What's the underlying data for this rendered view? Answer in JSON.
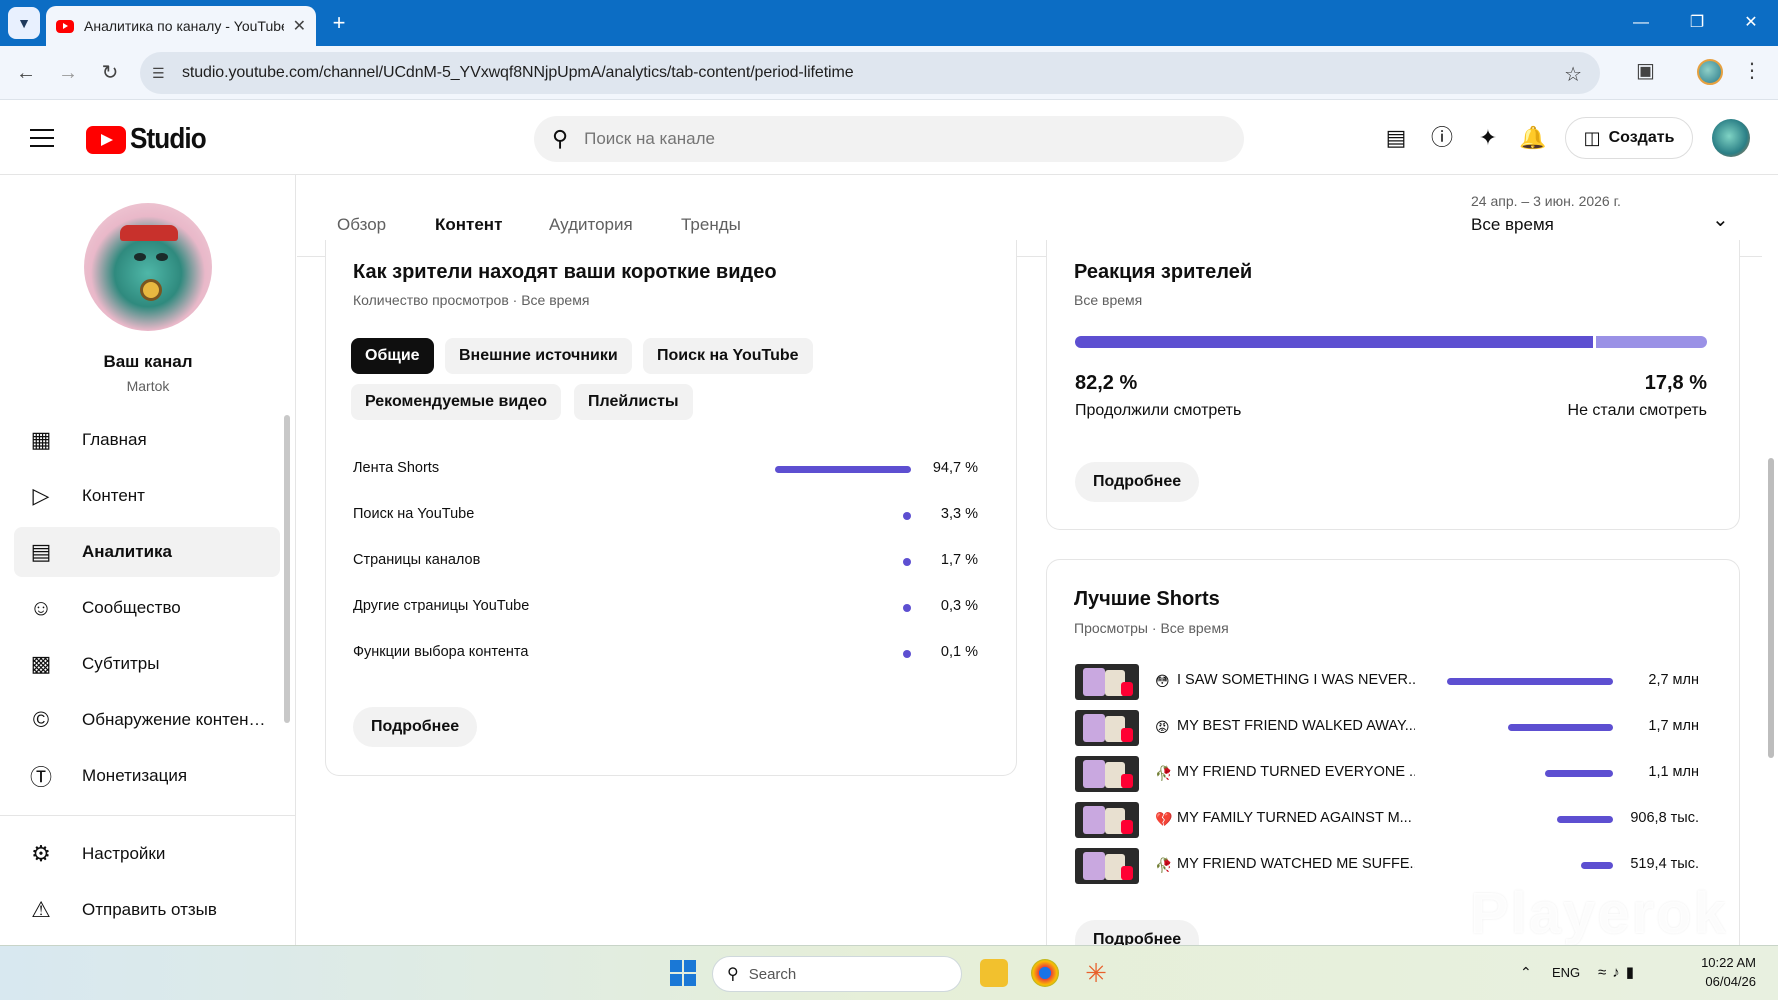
{
  "browser": {
    "tab_title": "Аналитика по каналу - YouTube",
    "url": "studio.youtube.com/channel/UCdnM-5_YVxwqf8NNjpUpmA/analytics/tab-content/period-lifetime"
  },
  "header": {
    "logo_text": "Studio",
    "search_placeholder": "Поиск на канале",
    "create_label": "Создать"
  },
  "sidebar": {
    "channel_name": "Ваш канал",
    "channel_handle": "Martok",
    "items": [
      {
        "label": "Главная",
        "icon": "dashboard-icon"
      },
      {
        "label": "Контент",
        "icon": "content-icon"
      },
      {
        "label": "Аналитика",
        "icon": "analytics-icon",
        "active": true
      },
      {
        "label": "Сообщество",
        "icon": "community-icon"
      },
      {
        "label": "Субтитры",
        "icon": "subtitles-icon"
      },
      {
        "label": "Обнаружение контен…",
        "icon": "copyright-icon"
      },
      {
        "label": "Монетизация",
        "icon": "dollar-icon"
      },
      {
        "label": "Настройки",
        "icon": "gear-icon"
      },
      {
        "label": "Отправить отзыв",
        "icon": "feedback-icon"
      }
    ]
  },
  "tabs": [
    {
      "label": "Обзор"
    },
    {
      "label": "Контент",
      "active": true
    },
    {
      "label": "Аудитория"
    },
    {
      "label": "Тренды"
    }
  ],
  "date": {
    "range": "24 апр. – 3 июн. 2026 г.",
    "value": "Все время"
  },
  "sources_card": {
    "title": "Как зрители находят ваши короткие видео",
    "subtitle": "Количество просмотров · Все время",
    "chips": [
      "Общие",
      "Внешние источники",
      "Поиск на YouTube",
      "Рекомендуемые видео",
      "Плейлисты"
    ],
    "rows": [
      {
        "label": "Лента Shorts",
        "value": "94,7 %",
        "pct": 94.7
      },
      {
        "label": "Поиск на YouTube",
        "value": "3,3 %",
        "pct": 3.3
      },
      {
        "label": "Страницы каналов",
        "value": "1,7 %",
        "pct": 1.7
      },
      {
        "label": "Другие страницы YouTube",
        "value": "0,3 %",
        "pct": 0.3
      },
      {
        "label": "Функции выбора контента",
        "value": "0,1 %",
        "pct": 0.1
      }
    ],
    "more_label": "Подробнее"
  },
  "reaction_card": {
    "title": "Реакция зрителей",
    "subtitle": "Все время",
    "continued_pct": "82,2 %",
    "continued_label": "Продолжили смотреть",
    "stopped_pct": "17,8 %",
    "stopped_label": "Не стали смотреть",
    "continued_value": 82.2,
    "more_label": "Подробнее"
  },
  "shorts_card": {
    "title": "Лучшие Shorts",
    "subtitle": "Просмотры · Все время",
    "items": [
      {
        "emoji": "😳",
        "title": "I SAW SOMETHING I WAS NEVER...",
        "value": "2,7 млн",
        "views": 2700000
      },
      {
        "emoji": "😡",
        "title": "MY BEST FRIEND WALKED AWAY...",
        "value": "1,7 млн",
        "views": 1700000
      },
      {
        "emoji": "🥀",
        "title": "MY FRIEND TURNED EVERYONE ...",
        "value": "1,1 млн",
        "views": 1100000
      },
      {
        "emoji": "💔",
        "title": "MY FAMILY TURNED AGAINST M...",
        "value": "906,8 тыс.",
        "views": 906800
      },
      {
        "emoji": "🥀",
        "title": "MY FRIEND WATCHED ME SUFFE...",
        "value": "519,4 тыс.",
        "views": 519400
      }
    ],
    "more_label": "Подробнее"
  },
  "watermark": "Playerok",
  "taskbar": {
    "search_label": "Search",
    "lang": "ENG",
    "time": "10:22 AM",
    "date": "06/04/26"
  },
  "colors": {
    "accent": "#5d4fd1",
    "accent_light": "#9a91e6",
    "youtube_red": "#ff0000",
    "chrome_blue": "#0c6dc4"
  }
}
